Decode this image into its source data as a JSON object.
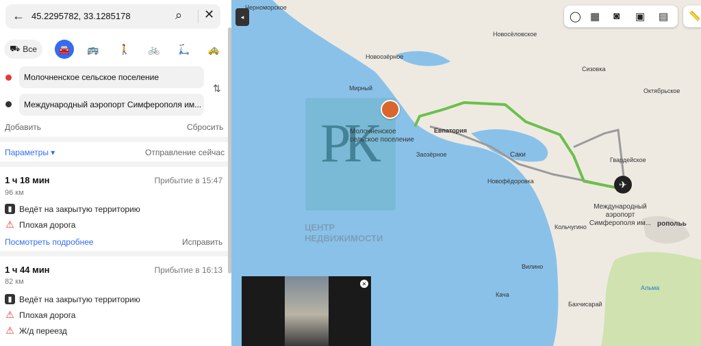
{
  "search": {
    "value": "45.2295782, 33.1285178"
  },
  "modes": {
    "all_label": "Все"
  },
  "route": {
    "from": "Молочненское сельское поселение",
    "to": "Международный аэропорт Симферополя им...",
    "add_label": "Добавить",
    "reset_label": "Сбросить",
    "params_label": "Параметры",
    "depart_label": "Отправление сейчас"
  },
  "routes": [
    {
      "duration": "1 ч 18 мин",
      "arrival": "Прибытие в 15:47",
      "distance": "96 км",
      "warnings": [
        "Ведёт на закрытую территорию",
        "Плохая дорога"
      ],
      "details_label": "Посмотреть подробнее",
      "fix_label": "Исправить"
    },
    {
      "duration": "1 ч 44 мин",
      "arrival": "Прибытие в 16:13",
      "distance": "82 км",
      "warnings": [
        "Ведёт на закрытую территорию",
        "Плохая дорога",
        "Ж/д переезд"
      ]
    }
  ],
  "map": {
    "places": {
      "chernomorskoe": "Черноморское",
      "novoselovskoe": "Новосёловское",
      "novoozernoe": "Новоозёрное",
      "mirny": "Мирный",
      "molochnenskoe": "Молочненское сельское поселение",
      "evpatoria": "Евпатория",
      "zaozernoe": "Заозёрное",
      "saki": "Саки",
      "novofedorovka": "Новофёдоровка",
      "sizovka": "Сизовка",
      "oktyabrskoe": "Октябрьское",
      "gvardeyskoe": "Гвардейское",
      "airport": "Международный аэропорт Симферополя им...",
      "kolchugino": "Кольчугино",
      "simferopol": "ропольь",
      "vilino": "Вилино",
      "kacha": "Кача",
      "bakhchisaray": "Бахчисарай",
      "alma": "Альма"
    },
    "watermark": {
      "letters": "РК",
      "line1": "ЦЕНТР",
      "line2": "НЕДВИЖИМОСТИ"
    }
  }
}
